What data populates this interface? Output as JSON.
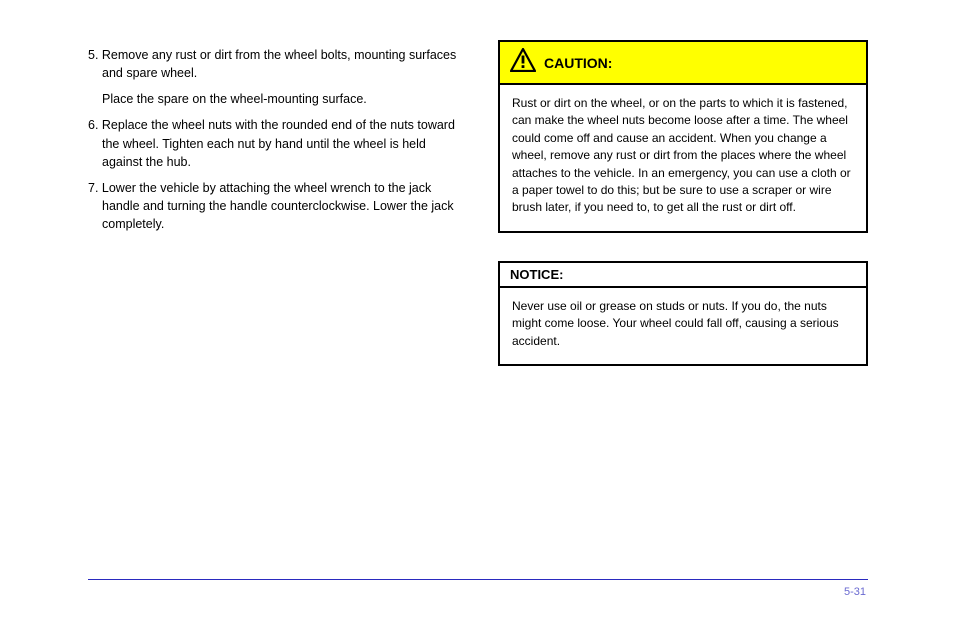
{
  "left": {
    "p1": "5. Remove any rust or dirt from the wheel bolts, mounting surfaces and spare wheel.",
    "p2": "Place the spare on the wheel-mounting surface.",
    "p3": "6. Replace the wheel nuts with the rounded end of the nuts toward the wheel. Tighten each nut by hand until the wheel is held against the hub.",
    "p4": "7. Lower the vehicle by attaching the wheel wrench to the jack handle and turning the handle counterclockwise. Lower the jack completely."
  },
  "caution": {
    "label": "CAUTION:",
    "body": "Rust or dirt on the wheel, or on the parts to which it is fastened, can make the wheel nuts become loose after a time. The wheel could come off and cause an accident. When you change a wheel, remove any rust or dirt from the places where the wheel attaches to the vehicle. In an emergency, you can use a cloth or a paper towel to do this; but be sure to use a scraper or wire brush later, if you need to, to get all the rust or dirt off."
  },
  "notice": {
    "label": "NOTICE:",
    "body": "Never use oil or grease on studs or nuts. If you do, the nuts might come loose. Your wheel could fall off, causing a serious accident."
  },
  "footer": {
    "left": "",
    "right": "5-31"
  }
}
